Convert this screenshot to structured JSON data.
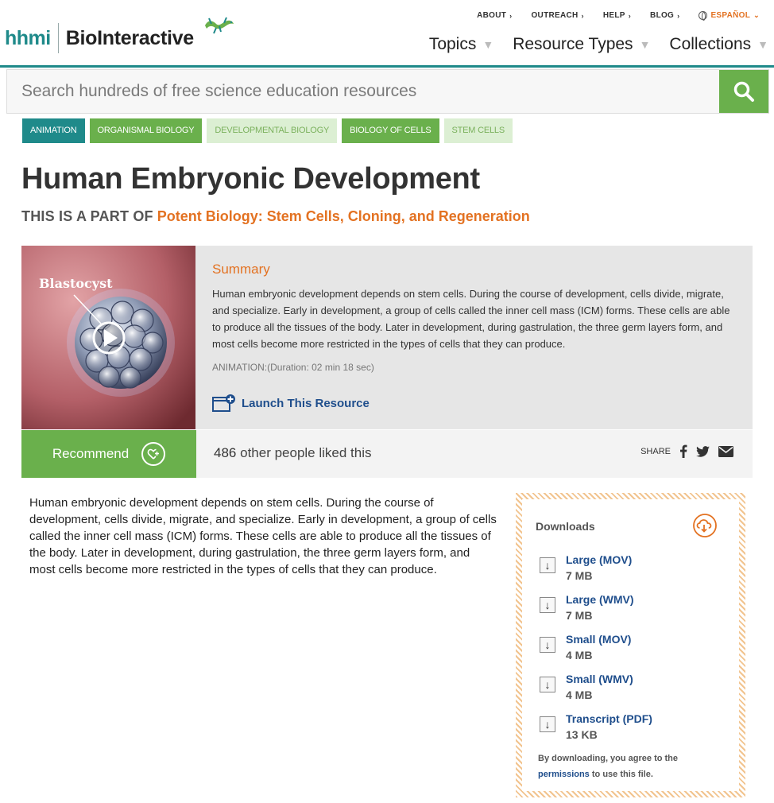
{
  "brand": {
    "org": "hhmi",
    "product": "BioInteractive"
  },
  "utility_nav": [
    {
      "label": "ABOUT"
    },
    {
      "label": "OUTREACH"
    },
    {
      "label": "HELP"
    },
    {
      "label": "BLOG"
    }
  ],
  "language": {
    "label": "ESPAÑOL"
  },
  "main_nav": [
    {
      "label": "Topics"
    },
    {
      "label": "Resource Types"
    },
    {
      "label": "Collections"
    }
  ],
  "search": {
    "placeholder": "Search hundreds of free science education resources"
  },
  "tags": [
    {
      "label": "ANIMATION",
      "style": "teal"
    },
    {
      "label": "ORGANISMAL BIOLOGY",
      "style": "green"
    },
    {
      "label": "DEVELOPMENTAL BIOLOGY",
      "style": "light"
    },
    {
      "label": "BIOLOGY OF CELLS",
      "style": "green"
    },
    {
      "label": "STEM CELLS",
      "style": "light"
    }
  ],
  "page": {
    "title": "Human Embryonic Development",
    "part_of_label": "THIS IS A PART OF",
    "part_of_link": "Potent Biology: Stem Cells, Cloning, and Regeneration"
  },
  "summary": {
    "thumbnail_label": "Blastocyst",
    "heading": "Summary",
    "text": "Human embryonic development depends on stem cells. During the course of development, cells divide, migrate, and specialize. Early in development, a group of cells called the inner cell mass (ICM) forms. These cells are able to produce all the tissues of the body. Later in development, during gastrulation, the three germ layers form, and most cells become more restricted in the types of cells that they can produce.",
    "duration": "ANIMATION:(Duration: 02 min 18 sec)",
    "launch_label": "Launch This Resource"
  },
  "social": {
    "recommend_label": "Recommend",
    "like_count": "486",
    "likes_suffix": "other people liked this",
    "share_label": "SHARE"
  },
  "description": "Human embryonic development depends on stem cells. During the course of development, cells divide, migrate, and specialize. Early in development, a group of cells called the inner cell mass (ICM) forms. These cells are able to produce all the tissues of the body. Later in development, during gastrulation, the three germ layers form, and most cells become more restricted in the types of cells that they can produce.",
  "downloads": {
    "heading": "Downloads",
    "items": [
      {
        "name": "Large (MOV)",
        "size": "7 MB"
      },
      {
        "name": "Large (WMV)",
        "size": "7 MB"
      },
      {
        "name": "Small (MOV)",
        "size": "4 MB"
      },
      {
        "name": "Small (WMV)",
        "size": "4 MB"
      },
      {
        "name": "Transcript (PDF)",
        "size": "13 KB"
      }
    ],
    "note_prefix": "By downloading, you agree to the",
    "note_link": "permissions",
    "note_suffix": "to use this file."
  },
  "colors": {
    "teal": "#1f8a8a",
    "green": "#6ab04c",
    "orange": "#e37222",
    "link_blue": "#1f4e8c"
  }
}
